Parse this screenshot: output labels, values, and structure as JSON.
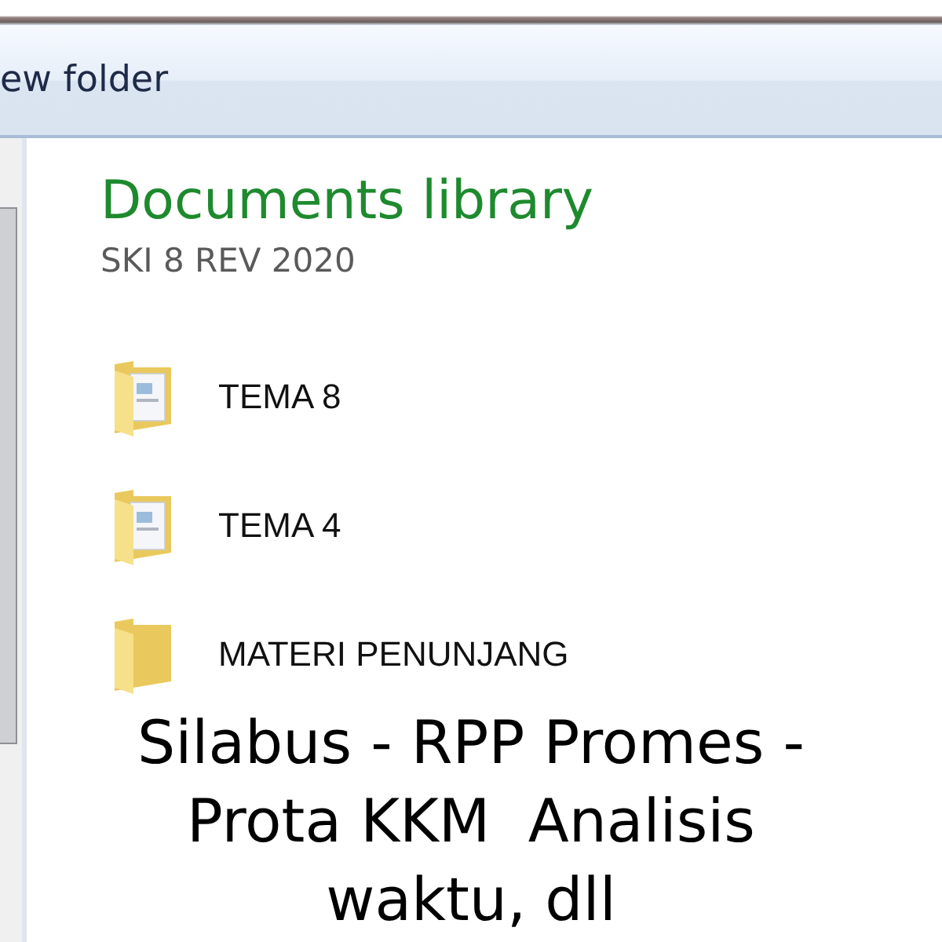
{
  "toolbar": {
    "new_folder": "ew folder"
  },
  "library": {
    "title": "Documents library",
    "subtitle": "SKI 8 REV 2020"
  },
  "items": [
    {
      "name": "TEMA 8",
      "kind": "documents"
    },
    {
      "name": "TEMA 4",
      "kind": "documents"
    },
    {
      "name": "MATERI PENUNJANG",
      "kind": "empty"
    }
  ],
  "caption": [
    "Silabus - RPP Promes -",
    "Prota KKM  Analisis",
    "waktu, dll"
  ]
}
